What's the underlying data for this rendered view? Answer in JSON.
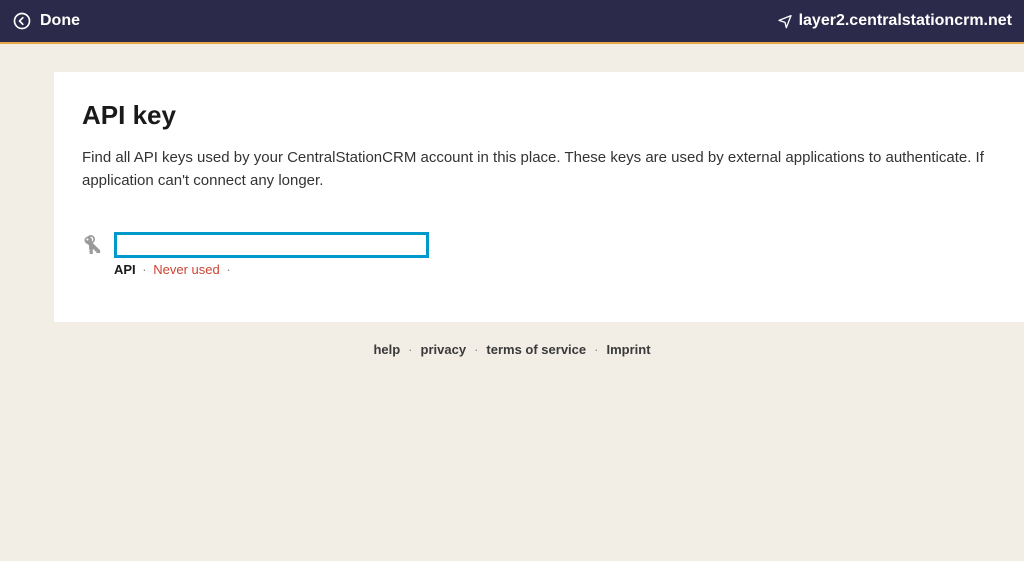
{
  "topbar": {
    "done_label": "Done",
    "domain": "layer2.centralstationcrm.net"
  },
  "page": {
    "title": "API key",
    "description": "Find all API keys used by your CentralStationCRM account in this place. These keys are used by external applications to authenticate. If application can't connect any longer."
  },
  "apikey": {
    "value": "",
    "label": "API",
    "status": "Never used",
    "separator": "·"
  },
  "footer": {
    "help": "help",
    "privacy": "privacy",
    "terms": "terms of service",
    "imprint": "Imprint",
    "separator": "·"
  }
}
